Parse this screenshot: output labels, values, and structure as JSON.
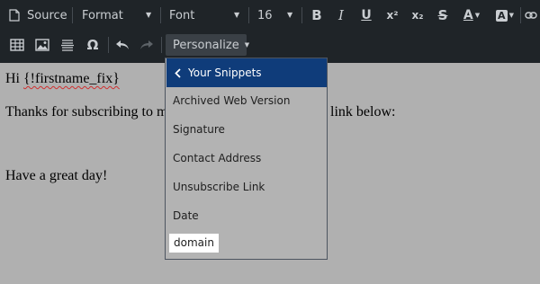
{
  "toolbar": {
    "source_label": "Source",
    "format_label": "Format",
    "font_label": "Font",
    "size_label": "16",
    "personalize_label": "Personalize",
    "icons": {
      "source": "page-icon",
      "bold": "B",
      "italic": "I",
      "underline": "U",
      "superscript": "x²",
      "subscript": "x₂",
      "strike": "S",
      "text_color": "A",
      "bg_color": "A",
      "link": "chain-link-icon",
      "table": "table-icon",
      "image": "image-icon",
      "hr": "horizontal-rule-icon",
      "omega": "Ω",
      "undo": "undo-icon",
      "redo": "redo-icon"
    }
  },
  "editor": {
    "line1_prefix": "Hi ",
    "line1_token": "{!firstname_fix}",
    "line2_start": "Thanks for subscribing to m",
    "line2_end": "link below:",
    "line3": "Have a great day!"
  },
  "menu": {
    "header": "Your Snippets",
    "items": [
      "Archived Web Version",
      "Signature",
      "Contact Address",
      "Unsubscribe Link",
      "Date",
      "domain"
    ]
  },
  "colors": {
    "toolbar_bg": "#1f2428",
    "menu_header_bg": "#0f3c7a",
    "content_bg": "#b0b0b0"
  }
}
